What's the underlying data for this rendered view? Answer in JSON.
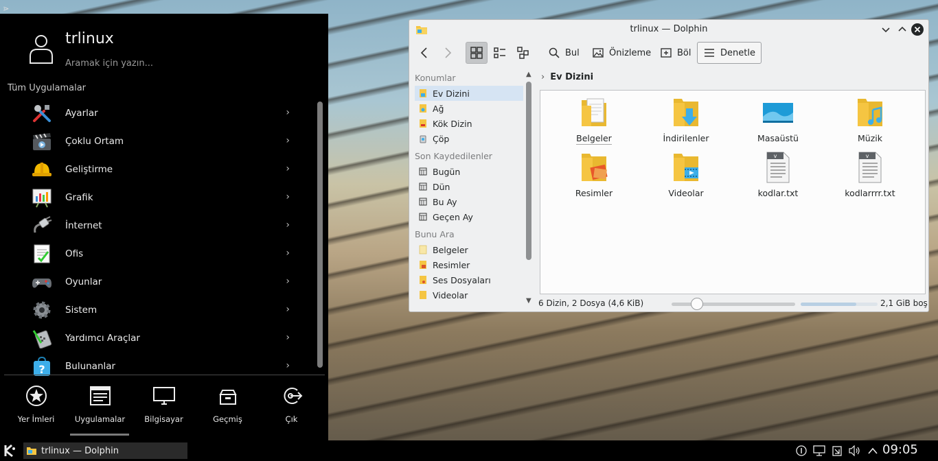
{
  "launcher": {
    "user_name": "trlinux",
    "search_placeholder": "Aramak için yazın...",
    "section_title": "Tüm Uygulamalar",
    "apps": [
      {
        "label": "Ayarlar",
        "icon": "tools-icon"
      },
      {
        "label": "Çoklu Ortam",
        "icon": "clapperboard-icon"
      },
      {
        "label": "Geliştirme",
        "icon": "hardhat-icon"
      },
      {
        "label": "Grafik",
        "icon": "graphics-chart-icon"
      },
      {
        "label": "İnternet",
        "icon": "network-cable-icon"
      },
      {
        "label": "Ofis",
        "icon": "office-document-icon"
      },
      {
        "label": "Oyunlar",
        "icon": "gamepad-icon"
      },
      {
        "label": "Sistem",
        "icon": "gear-icon"
      },
      {
        "label": "Yardımcı Araçlar",
        "icon": "calculator-icon"
      },
      {
        "label": "Bulunanlar",
        "icon": "help-bag-icon"
      }
    ],
    "tabs": [
      {
        "label": "Yer İmleri",
        "icon": "star-icon"
      },
      {
        "label": "Uygulamalar",
        "icon": "applications-window-icon"
      },
      {
        "label": "Bilgisayar",
        "icon": "monitor-icon"
      },
      {
        "label": "Geçmiş",
        "icon": "history-box-icon"
      },
      {
        "label": "Çık",
        "icon": "logout-icon"
      }
    ],
    "active_tab": "Uygulamalar"
  },
  "dolphin": {
    "title": "trlinux — Dolphin",
    "toolbar": {
      "find": "Bul",
      "preview": "Önizleme",
      "split": "Böl",
      "control": "Denetle"
    },
    "places": {
      "groups": [
        {
          "title": "Konumlar",
          "items": [
            "Ev Dizini",
            "Ağ",
            "Kök Dizin",
            "Çöp"
          ]
        },
        {
          "title": "Son Kaydedilenler",
          "items": [
            "Bugün",
            "Dün",
            "Bu Ay",
            "Geçen Ay"
          ]
        },
        {
          "title": "Bunu Ara",
          "items": [
            "Belgeler",
            "Resimler",
            "Ses Dosyaları",
            "Videolar"
          ]
        }
      ],
      "selected": "Ev Dizini"
    },
    "breadcrumb": "Ev Dizini",
    "files": [
      {
        "label": "Belgeler",
        "icon": "folder-documents-icon"
      },
      {
        "label": "İndirilenler",
        "icon": "folder-downloads-icon"
      },
      {
        "label": "Masaüstü",
        "icon": "desktop-icon"
      },
      {
        "label": "Müzik",
        "icon": "folder-music-icon"
      },
      {
        "label": "Resimler",
        "icon": "folder-pictures-icon"
      },
      {
        "label": "Videolar",
        "icon": "folder-videos-icon"
      },
      {
        "label": "kodlar.txt",
        "icon": "text-file-icon"
      },
      {
        "label": "kodlarrrr.txt",
        "icon": "text-file-icon"
      }
    ],
    "status": "6 Dizin, 2 Dosya (4,6 KiB)",
    "free_space": "2,1 GiB boş",
    "disk_used_fraction": 0.72
  },
  "taskbar": {
    "task_label": "trlinux — Dolphin",
    "clock": "09:05"
  },
  "colors": {
    "launcher_bg": "#000000",
    "selection": "#d6e4f3",
    "folder_yellow": "#f5c542",
    "accent_blue": "#3daee9"
  }
}
